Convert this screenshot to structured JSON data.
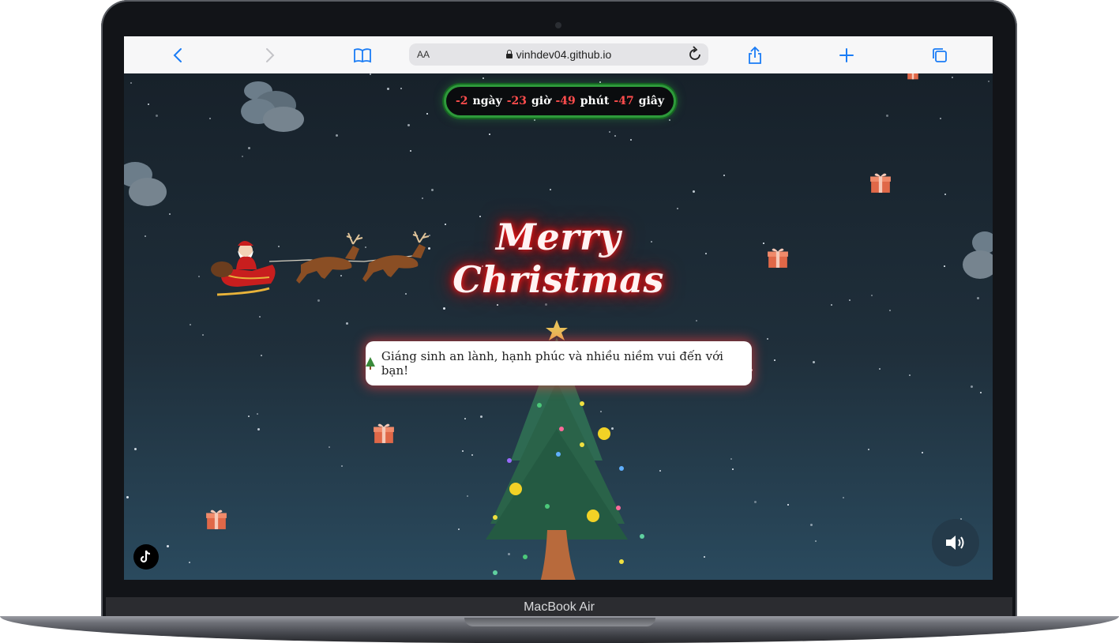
{
  "device": {
    "label": "MacBook Air"
  },
  "browser": {
    "url": "vinhdev04.github.io",
    "text_size_label": "AA"
  },
  "page": {
    "countdown": {
      "days": "-2",
      "days_unit": "ngày",
      "hours": "-23",
      "hours_unit": "giờ",
      "minutes": "-49",
      "minutes_unit": "phút",
      "seconds": "-47",
      "seconds_unit": "giây"
    },
    "title": "Merry Christmas",
    "message": "Giáng sinh an lành, hạnh phúc và nhiều niềm vui đến với bạn!",
    "colors": {
      "countdown_number": "#ff4d4d",
      "countdown_border": "#2e9a3b",
      "title_glow": "#ff2020",
      "background_top": "#17212a",
      "background_bottom": "#2a4a5e"
    },
    "icons": [
      "back-icon",
      "forward-icon",
      "bookmarks-icon",
      "lock-icon",
      "reload-icon",
      "share-icon",
      "new-tab-icon",
      "tabs-icon",
      "speaker-icon",
      "tiktok-icon",
      "gift-icon",
      "cloud-icon",
      "sleigh-icon",
      "christmas-tree-icon"
    ]
  }
}
